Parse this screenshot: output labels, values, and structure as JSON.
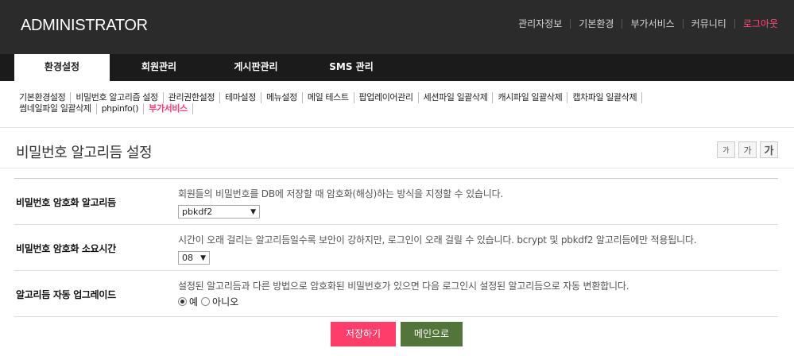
{
  "header": {
    "logo": "ADMINISTRATOR",
    "links": [
      "관리자정보",
      "기본환경",
      "부가서비스",
      "커뮤니티"
    ],
    "logout": "로그아웃"
  },
  "main_nav": {
    "tabs": [
      "환경설정",
      "회원관리",
      "게시판관리",
      "SMS 관리"
    ],
    "active": "환경설정"
  },
  "sub_nav": {
    "items": [
      "기본환경설정",
      "비밀번호 알고리즘 설정",
      "관리권한설정",
      "테마설정",
      "메뉴설정",
      "메일 테스트",
      "팝업레이어관리",
      "세션파일 일괄삭제",
      "캐시파일 일괄삭제",
      "캡차파일 일괄삭제",
      "썸네일파일 일괄삭제",
      "phpinfo()",
      "부가서비스"
    ],
    "highlight": "부가서비스"
  },
  "page": {
    "title": "비밀번호 알고리듬 설정",
    "font_buttons": [
      "가",
      "가",
      "가"
    ]
  },
  "form": {
    "rows": [
      {
        "label": "비밀번호 암호화 알고리듬",
        "desc": "회원들의 비밀번호를 DB에 저장할 때 암호화(해싱)하는 방식을 지정할 수 있습니다.",
        "select_value": "pbkdf2"
      },
      {
        "label": "비밀번호 암호화 소요시간",
        "desc": "시간이 오래 걸리는 알고리듬일수록 보안이 강하지만, 로그인이 오래 걸릴 수 있습니다. bcrypt 및 pbkdf2 알고리듬에만 적용됩니다.",
        "select_value": "08"
      },
      {
        "label": "알고리듬 자동 업그레이드",
        "desc": "설정된 알고리듬과 다른 방법으로 암호화된 비밀번호가 있으면 다음 로그인시 설정된 알고리듬으로 자동 변환합니다.",
        "radio_yes": "예",
        "radio_no": "아니오",
        "selected": "예"
      }
    ]
  },
  "buttons": {
    "save": "저장하기",
    "main": "메인으로"
  },
  "colors": {
    "header_bg": "#2b2b2b",
    "nav_bg": "#1b1b1b",
    "accent_pink": "#ff3d6b",
    "accent_green": "#53743a"
  }
}
